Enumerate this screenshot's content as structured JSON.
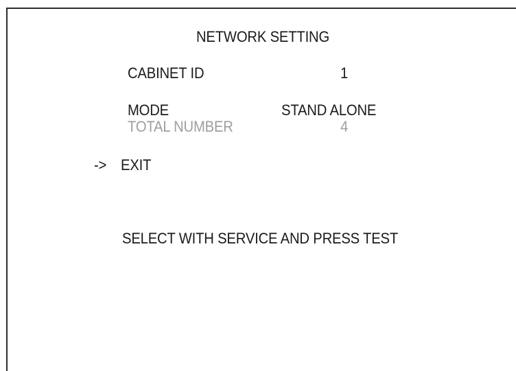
{
  "screen": {
    "title": "NETWORK SETTING",
    "colors": {
      "text": "#1a1a1a",
      "disabled_text": "#9e9e9e",
      "border": "#2b2b2b",
      "background": "#ffffff"
    }
  },
  "settings": [
    {
      "label": "CABINET ID",
      "value": "1",
      "enabled": true
    },
    {
      "label": "MODE",
      "value": "STAND ALONE",
      "enabled": true
    },
    {
      "label": "TOTAL NUMBER",
      "value": "4",
      "enabled": false
    }
  ],
  "menu": {
    "cursor": "->",
    "exit_label": "EXIT"
  },
  "footer": {
    "instruction": "SELECT WITH SERVICE AND PRESS TEST"
  }
}
